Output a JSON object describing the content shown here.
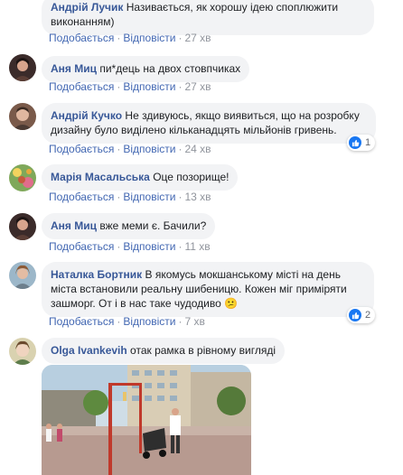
{
  "comments": [
    {
      "author": "Андрій Лучик",
      "text": "Називається, як хорошу ідею споплюжити виконанням)",
      "like_label": "Подобається",
      "reply_label": "Відповісти",
      "time": "27 хв"
    },
    {
      "author": "Аня Миц",
      "text": "пи*дець на двох стовпчиках",
      "like_label": "Подобається",
      "reply_label": "Відповісти",
      "time": "27 хв"
    },
    {
      "author": "Андрій Кучко",
      "text": "Не здивуюсь, якщо виявиться, що на розробку дизайну було виділено кільканадцять мільйонів гривень.",
      "like_label": "Подобається",
      "reply_label": "Відповісти",
      "time": "24 хв",
      "reaction_count": "1"
    },
    {
      "author": "Марія Масальська",
      "text": "Оце позорище!",
      "like_label": "Подобається",
      "reply_label": "Відповісти",
      "time": "13 хв"
    },
    {
      "author": "Аня Миц",
      "text": "вже меми є. Бачили?",
      "like_label": "Подобається",
      "reply_label": "Відповісти",
      "time": "11 хв"
    },
    {
      "author": "Наталка Бортник",
      "text": "В якомусь мокшанському місті на день міста встановили реальну шибеницю. Кожен міг приміряти зашморг. От і в нас таке чудодиво",
      "emoji": "😕",
      "like_label": "Подобається",
      "reply_label": "Відповісти",
      "time": "7 хв",
      "reaction_count": "2"
    },
    {
      "author": "Olga Ivankevih",
      "text": "отак рамка в рівному вигляді"
    }
  ],
  "separator": "·",
  "icons": {
    "like": "thumbs-up-icon",
    "emoji": "confused-face-emoji"
  },
  "colors": {
    "author": "#385898",
    "link": "#4267b2",
    "bubble": "#f2f3f5",
    "like_badge": "#1877f2"
  }
}
